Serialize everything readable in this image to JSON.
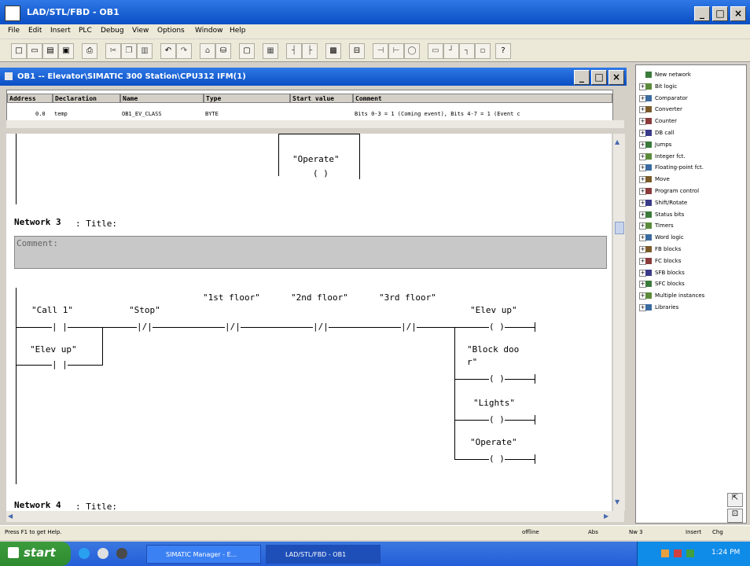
{
  "window": {
    "title": "LAD/STL/FBD  -  OB1",
    "minimize": "_",
    "maximize": "□",
    "close": "×"
  },
  "menu": [
    "File",
    "Edit",
    "Insert",
    "PLC",
    "Debug",
    "View",
    "Options",
    "Window",
    "Help"
  ],
  "child_window": {
    "title": "OB1 -- Elevator\\SIMATIC 300 Station\\CPU312 IFM(1)"
  },
  "declaration": {
    "headers": [
      "Address",
      "Declaration",
      "Name",
      "Type",
      "Start value",
      "Comment"
    ],
    "row": [
      "0.0",
      "temp",
      "OB1_EV_CLASS",
      "BYTE",
      "",
      "Bits 0-3 = 1 (Coming event), Bits 4-7 = 1 (Event c"
    ]
  },
  "editor": {
    "top_coil_label": "\"Operate\"",
    "network3_label": "Network 3",
    "network3_title": ": Title:",
    "comment_label": "Comment:",
    "contacts": {
      "call1": "\"Call 1\"",
      "stop": "\"Stop\"",
      "floor1": "\"1st floor\"",
      "floor2": "\"2nd floor\"",
      "floor3": "\"3rd floor\"",
      "elev_up_contact": "\"Elev up\""
    },
    "coils": {
      "elev_up": "\"Elev up\"",
      "block_door_1": "\"Block doo",
      "block_door_2": "r\"",
      "lights": "\"Lights\"",
      "operate": "\"Operate\""
    },
    "network4_label": "Network 4",
    "network4_title": ": Title:"
  },
  "catalog": {
    "items": [
      "New network",
      "Bit logic",
      "Comparator",
      "Converter",
      "Counter",
      "DB call",
      "Jumps",
      "Integer fct.",
      "Floating-point fct.",
      "Move",
      "Program control",
      "Shift/Rotate",
      "Status bits",
      "Timers",
      "Word logic",
      "FB blocks",
      "FC blocks",
      "SFB blocks",
      "SFC blocks",
      "Multiple instances",
      "Libraries"
    ]
  },
  "status": {
    "hint": "Press F1 to get Help.",
    "mode": "offline",
    "abs": "Abs",
    "nw": "Nw 3",
    "insert": "Insert",
    "chg": "Chg"
  },
  "taskbar": {
    "start": "start",
    "tasks": [
      "SIMATIC Manager - E...",
      "LAD/STL/FBD - OB1"
    ],
    "clock": "1:24 PM"
  }
}
